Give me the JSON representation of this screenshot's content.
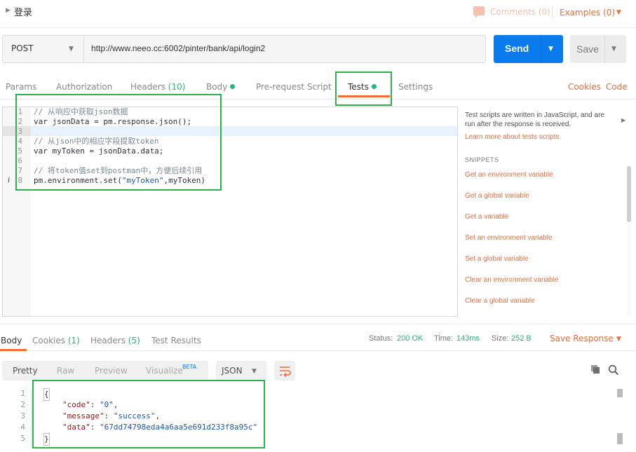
{
  "request": {
    "title": "登录",
    "comments_label": "Comments (0)",
    "examples_label": "Examples (0)",
    "method": "POST",
    "url": "http://www.neeo.cc:6002/pinter/bank/api/login2",
    "send_label": "Send",
    "save_label": "Save"
  },
  "request_tabs": {
    "params": "Params",
    "authorization": "Authorization",
    "headers": "Headers",
    "headers_count": "(10)",
    "body": "Body",
    "prerequest": "Pre-request Script",
    "tests": "Tests",
    "settings": "Settings",
    "cookies": "Cookies",
    "code": "Code"
  },
  "editor": {
    "line_numbers": [
      "1",
      "2",
      "3",
      "4",
      "5",
      "6",
      "7",
      "8"
    ],
    "lines": {
      "l1": "// 从响应中获取json数据",
      "l2": "var jsonData = pm.response.json();",
      "l4": "// 从json中的相应字段提取token",
      "l5": "var myToken = jsonData.data;",
      "l7": "// 将token值set到postman中，方便后续引用",
      "l8a": "pm.environment.set(",
      "l8b": "\"myToken\"",
      "l8c": ",myToken)"
    },
    "info_marker": "i"
  },
  "snippets": {
    "description": "Test scripts are written in JavaScript, and are run after the response is received.",
    "learn_more": "Learn more about tests scripts",
    "heading": "SNIPPETS",
    "items": [
      "Get an environment variable",
      "Get a global variable",
      "Get a variable",
      "Set an environment variable",
      "Set a global variable",
      "Clear an environment variable",
      "Clear a global variable"
    ]
  },
  "response_tabs": {
    "body": "Body",
    "cookies": "Cookies",
    "cookies_count": "(1)",
    "headers": "Headers",
    "headers_count": "(5)",
    "test_results": "Test Results"
  },
  "response_meta": {
    "status_label": "Status:",
    "status_value": "200 OK",
    "time_label": "Time:",
    "time_value": "143ms",
    "size_label": "Size:",
    "size_value": "252 B",
    "save_response": "Save Response"
  },
  "response_toolbar": {
    "pretty": "Pretty",
    "raw": "Raw",
    "preview": "Preview",
    "visualize": "Visualize",
    "beta": "BETA",
    "format": "JSON"
  },
  "response_body": {
    "line_numbers": [
      "1",
      "2",
      "3",
      "4",
      "5"
    ],
    "open_brace": "{",
    "close_brace": "}",
    "k1": "\"code\"",
    "v1": "\"0\"",
    "k2": "\"message\"",
    "v2": "\"success\"",
    "k3": "\"data\"",
    "v3": "\"67dd74798eda4a6aa5e691d233f8a95c\""
  },
  "colors": {
    "accent": "#f26b3a",
    "primary": "#097bed",
    "success": "#26b47f",
    "annotation": "#2bb34b"
  }
}
